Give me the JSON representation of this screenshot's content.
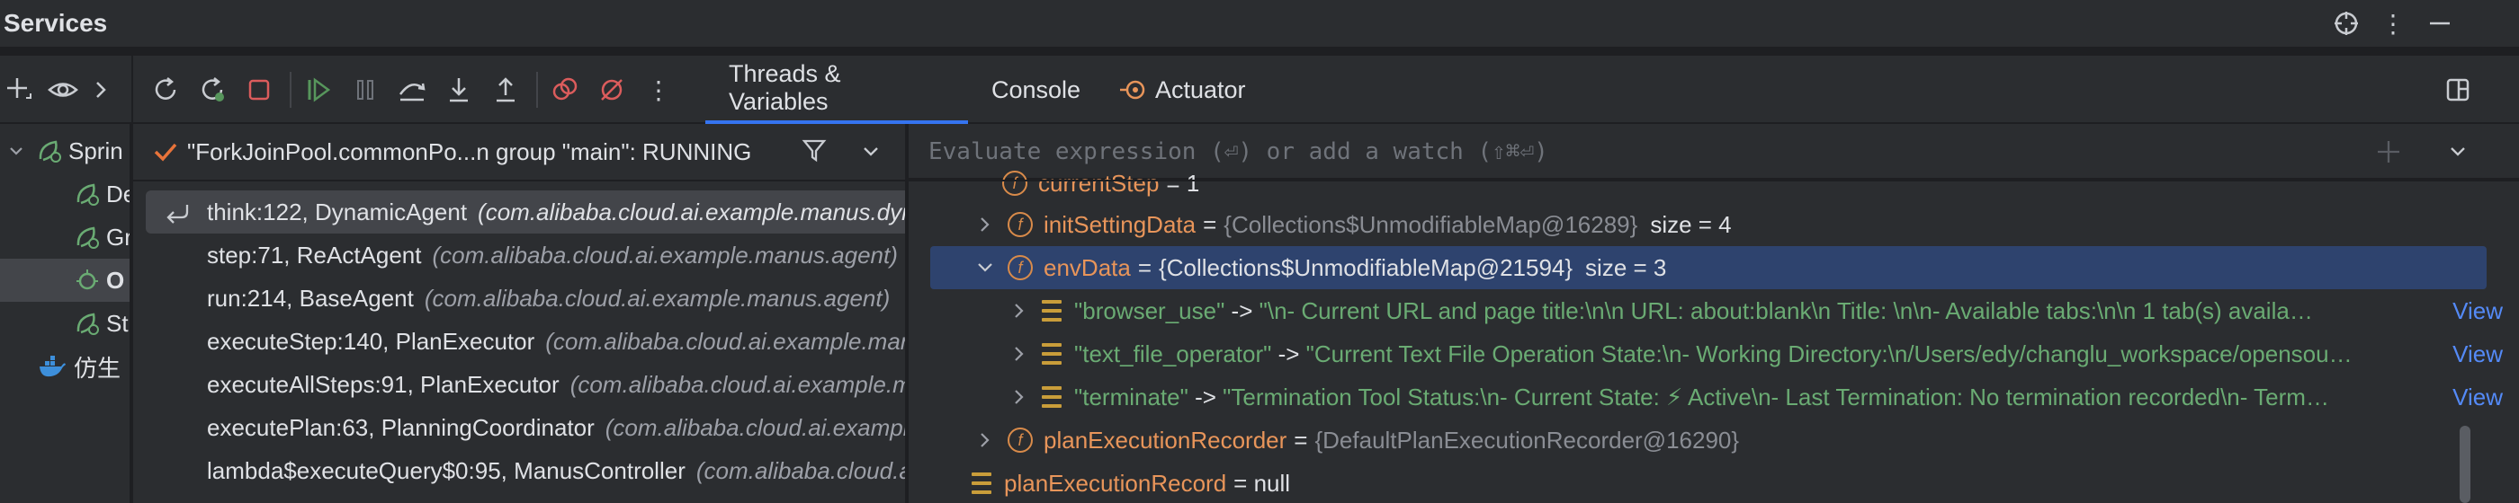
{
  "header": {
    "title": "Services",
    "icons": [
      "crosshair-icon",
      "more-vertical-icon",
      "minimize-icon"
    ]
  },
  "tabs": [
    {
      "label": "Threads & Variables",
      "active": true
    },
    {
      "label": "Console",
      "active": false
    },
    {
      "label": "Actuator",
      "active": false
    }
  ],
  "tree": {
    "items": [
      {
        "label": "Sprin",
        "icon": "spring-icon"
      },
      {
        "label": "De",
        "icon": "spring-run-icon"
      },
      {
        "label": "Gr",
        "icon": "spring-run-icon"
      },
      {
        "label": "O",
        "icon": "spring-debug-icon"
      },
      {
        "label": "St",
        "icon": "spring-run-icon"
      },
      {
        "label": "仿生",
        "icon": "docker-icon"
      }
    ]
  },
  "frames": {
    "thread_label": "\"ForkJoinPool.commonPo...n group \"main\": RUNNING",
    "rows": [
      {
        "method": "think:122, DynamicAgent",
        "cls": "(com.alibaba.cloud.ai.example.manus.dynamic.agent"
      },
      {
        "method": "step:71, ReActAgent",
        "cls": "(com.alibaba.cloud.ai.example.manus.agent)"
      },
      {
        "method": "run:214, BaseAgent",
        "cls": "(com.alibaba.cloud.ai.example.manus.agent)"
      },
      {
        "method": "executeStep:140, PlanExecutor",
        "cls": "(com.alibaba.cloud.ai.example.manus.planning)"
      },
      {
        "method": "executeAllSteps:91, PlanExecutor",
        "cls": "(com.alibaba.cloud.ai.example.manus.planning)"
      },
      {
        "method": "executePlan:63, PlanningCoordinator",
        "cls": "(com.alibaba.cloud.ai.example.manus.planning)"
      },
      {
        "method": "lambda$executeQuery$0:95, ManusController",
        "cls": "(com.alibaba.cloud.ai.example.manus)"
      }
    ]
  },
  "eval": {
    "placeholder": "Evaluate expression (⏎) or add a watch (⇧⌘⏎)"
  },
  "vars": {
    "current_step": {
      "name": "currentStep",
      "value": "= 1"
    },
    "init_setting": {
      "name": "initSettingData",
      "ref": "{Collections$UnmodifiableMap@16289}",
      "size": "size = 4"
    },
    "env_data": {
      "name": "envData",
      "ref": "{Collections$UnmodifiableMap@21594}",
      "size": "size = 3"
    },
    "entries": [
      {
        "key": "\"browser_use\"",
        "arrow": " -> ",
        "value": "\"\\n- Current URL and page title:\\n\\n   URL: about:blank\\n   Title: \\n\\n- Available tabs:\\n\\n   1 tab(s) availa…"
      },
      {
        "key": "\"text_file_operator\"",
        "arrow": " -> ",
        "value": "\"Current Text File Operation State:\\n- Working Directory:\\n/Users/edy/changlu_workspace/opensou…"
      },
      {
        "key": "\"terminate\"",
        "arrow": " -> ",
        "value": "\"Termination Tool Status:\\n- Current State: ⚡ Active\\n- Last Termination: No termination recorded\\n- Term…"
      }
    ],
    "view_label": "View",
    "recorder": {
      "name": "planExecutionRecorder",
      "ref": "{DefaultPlanExecutionRecorder@16290}"
    },
    "record": {
      "name": "planExecutionRecord",
      "value": "= null"
    }
  },
  "colors": {
    "accent": "#3574f0",
    "field": "#e8955a",
    "string": "#6aab73",
    "selection": "#2e436e"
  }
}
